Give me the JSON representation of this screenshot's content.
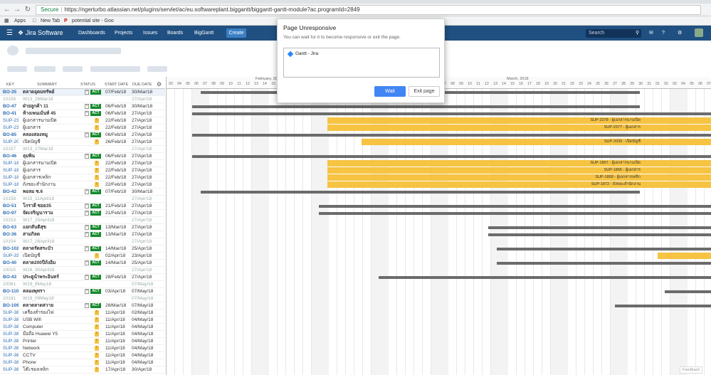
{
  "browser": {
    "security": "Secure",
    "url": "https://ngerturbo.atlassian.net/plugins/servlet/ac/eu.softwareplant.biggantt/biggantt-gantt-module?ac.programId=2849",
    "bookmarks": [
      "Apps",
      "New Tab",
      "potential site - Goo"
    ]
  },
  "jira": {
    "brand": "Jira Software",
    "nav": [
      "Dashboards",
      "Projects",
      "Issues",
      "Boards",
      "BigGantt"
    ],
    "create": "Create",
    "search_placeholder": "Search"
  },
  "table": {
    "headers": [
      "KEY",
      "SUMMARY",
      "STATUS",
      "START DATE",
      "DUE DATE"
    ],
    "rows": [
      {
        "key": "BO-35",
        "summary": "ตลาดอุดมทรัพย์",
        "status": "ACT",
        "start": "07/Feb/18",
        "due": "30/Mar/18",
        "type": "bold"
      },
      {
        "key": "10156",
        "summary": "W13_26Mar18",
        "status": "",
        "start": "",
        "due": "27/Apr/18",
        "type": "ver"
      },
      {
        "key": "BO-47",
        "summary": "ฝ่ายลูกค้า 11",
        "status": "ACT",
        "start": "06/Feb/18",
        "due": "30/Mar/18",
        "type": "bold"
      },
      {
        "key": "BO-41",
        "summary": "ห้างเพนเม้นท์ 45",
        "status": "ACT",
        "start": "06/Feb/18",
        "due": "27/Apr/18",
        "type": "bold"
      },
      {
        "key": "SUP-23",
        "summary": "ผู้เอกสารนาบเปิด",
        "status": "!",
        "start": "22/Feb/18",
        "due": "27/Apr/18",
        "type": "sub"
      },
      {
        "key": "SUP-23",
        "summary": "ผู้เอกสาร",
        "status": "!",
        "start": "22/Feb/18",
        "due": "27/Apr/18",
        "type": "sub"
      },
      {
        "key": "BO-85",
        "summary": "คลองสองหมู",
        "status": "ACT",
        "start": "06/Feb/18",
        "due": "27/Apr/18",
        "type": "bold"
      },
      {
        "key": "SUP-20",
        "summary": "เปิดบัญชี",
        "status": "!",
        "start": "26/Feb/18",
        "due": "27/Apr/18",
        "type": "sub"
      },
      {
        "key": "10157",
        "summary": "W13_27Mar18",
        "status": "",
        "start": "",
        "due": "27/Apr/18",
        "type": "ver"
      },
      {
        "key": "BO-46",
        "summary": "ลุมพิน",
        "status": "ACT",
        "start": "06/Feb/18",
        "due": "27/Apr/18",
        "type": "bold"
      },
      {
        "key": "SUP-18",
        "summary": "ผู้เอกสารนาบเปิด",
        "status": "!",
        "start": "22/Feb/18",
        "due": "27/Apr/18",
        "type": "sub"
      },
      {
        "key": "SUP-18",
        "summary": "ผู้เอกสาร",
        "status": "!",
        "start": "22/Feb/18",
        "due": "27/Apr/18",
        "type": "sub"
      },
      {
        "key": "SUP-18",
        "summary": "ผู้เอกสารเหล็ก",
        "status": "!",
        "start": "22/Feb/18",
        "due": "27/Apr/18",
        "type": "sub"
      },
      {
        "key": "SUP-18",
        "summary": "ถังขยะสำนักงาน",
        "status": "!",
        "start": "22/Feb/18",
        "due": "27/Apr/18",
        "type": "sub"
      },
      {
        "key": "BO-42",
        "summary": "พอลม ซ.6",
        "status": "ACT",
        "start": "07/Feb/18",
        "due": "30/Mar/18",
        "type": "bold"
      },
      {
        "key": "10158",
        "summary": "W15_11April18",
        "status": "",
        "start": "",
        "due": "27/Apr/18",
        "type": "ver"
      },
      {
        "key": "BO-51",
        "summary": "โกราดี ซอย35",
        "status": "ACT",
        "start": "21/Feb/18",
        "due": "27/Apr/18",
        "type": "bold"
      },
      {
        "key": "BO-97",
        "summary": "จัดเจริญนาราม",
        "status": "ACT",
        "start": "21/Feb/18",
        "due": "27/Apr/18",
        "type": "bold"
      },
      {
        "key": "10153",
        "summary": "W17_25April18",
        "status": "",
        "start": "",
        "due": "27/Apr/18",
        "type": "ver"
      },
      {
        "key": "BO-63",
        "summary": "แยกสันติสุข",
        "status": "ACT",
        "start": "13/Mar/18",
        "due": "27/Apr/18",
        "type": "bold"
      },
      {
        "key": "BO-36",
        "summary": "สามกิลด",
        "status": "ACT",
        "start": "13/Mar/18",
        "due": "27/Apr/18",
        "type": "bold"
      },
      {
        "key": "10154",
        "summary": "W17_26April18",
        "status": "",
        "start": "",
        "due": "27/Apr/18",
        "type": "ver"
      },
      {
        "key": "BO-102",
        "summary": "ตลาดรัดสระบัว",
        "status": "ACT",
        "start": "14/Mar/18",
        "due": "25/Apr/18",
        "type": "bold"
      },
      {
        "key": "SUP-33",
        "summary": "เปิดบัญชี",
        "status": "!",
        "start": "02/Apr/18",
        "due": "23/Apr/18",
        "type": "sub"
      },
      {
        "key": "BO-40",
        "summary": "ตลาด200ปีถังอิ่ม",
        "status": "ACT",
        "start": "14/Mar/18",
        "due": "25/Apr/18",
        "type": "bold"
      },
      {
        "key": "10015",
        "summary": "W16_30April18",
        "status": "",
        "start": "",
        "due": "27/Apr/18",
        "type": "ver"
      },
      {
        "key": "BO-43",
        "summary": "ประตูน้ำพระอินทร์",
        "status": "ACT",
        "start": "28/Feb/18",
        "due": "27/Apr/18",
        "type": "bold"
      },
      {
        "key": "10061",
        "summary": "W19_8May18",
        "status": "",
        "start": "",
        "due": "07/May/18",
        "type": "ver"
      },
      {
        "key": "BO-110",
        "summary": "คลองพุทรา",
        "status": "ACT",
        "start": "03/Apr/18",
        "due": "07/May/18",
        "type": "bold"
      },
      {
        "key": "10181",
        "summary": "W19_09May18",
        "status": "",
        "start": "",
        "due": "07/May/18",
        "type": "ver"
      },
      {
        "key": "BO-109",
        "summary": "ตลาดลาดสวาย",
        "status": "ACT",
        "start": "28/Mar/18",
        "due": "07/May/18",
        "type": "bold"
      },
      {
        "key": "SUP-38",
        "summary": "เครื่องสำรองไฟ",
        "status": "!",
        "start": "11/Apr/18",
        "due": "02/May/18",
        "type": "sub"
      },
      {
        "key": "SUP-38",
        "summary": "USB Wifi",
        "status": "!",
        "start": "11/Apr/18",
        "due": "04/May/18",
        "type": "sub"
      },
      {
        "key": "SUP-38",
        "summary": "Computer",
        "status": "!",
        "start": "11/Apr/18",
        "due": "04/May/18",
        "type": "sub"
      },
      {
        "key": "SUP-38",
        "summary": "มือถือ Huawei Y5",
        "status": "!",
        "start": "11/Apr/18",
        "due": "04/May/18",
        "type": "sub"
      },
      {
        "key": "SUP-38",
        "summary": "Printer",
        "status": "!",
        "start": "11/Apr/18",
        "due": "04/May/18",
        "type": "sub"
      },
      {
        "key": "SUP-38",
        "summary": "Network",
        "status": "!",
        "start": "11/Apr/18",
        "due": "04/May/18",
        "type": "sub"
      },
      {
        "key": "SUP-38",
        "summary": "CCTV",
        "status": "!",
        "start": "11/Apr/18",
        "due": "04/May/18",
        "type": "sub"
      },
      {
        "key": "SUP-38",
        "summary": "Phone",
        "status": "!",
        "start": "11/Apr/18",
        "due": "04/May/18",
        "type": "sub"
      },
      {
        "key": "SUP-38",
        "summary": "โต๊ะรองเหล็ก",
        "status": "!",
        "start": "17/Apr/18",
        "due": "30/Apr/18",
        "type": "sub"
      }
    ]
  },
  "gantt": {
    "months": [
      "February, 20",
      "March, 2018"
    ],
    "days": [
      "03",
      "04",
      "05",
      "06",
      "07",
      "08",
      "09",
      "10",
      "11",
      "12",
      "13",
      "14",
      "15",
      "16",
      "17",
      "18",
      "19",
      "20",
      "21",
      "22",
      "23",
      "24",
      "25",
      "26",
      "27",
      "28",
      "01",
      "02",
      "03",
      "04",
      "05",
      "06",
      "07",
      "08",
      "09",
      "10",
      "11",
      "12",
      "13",
      "14",
      "15",
      "16",
      "17",
      "18",
      "19",
      "20",
      "21",
      "22",
      "23",
      "24",
      "25",
      "26",
      "27",
      "28",
      "29",
      "30",
      "31",
      "01",
      "02",
      "03",
      "04",
      "05",
      "06",
      "07"
    ],
    "yellow_labels": [
      "SUP-2378 - ผู้เอกสารนาบเปิด",
      "SUP-2377 - ผู้เอกสาร",
      "SUP-2036 - เปิดบัญชี",
      "SUP-1867 - ผู้เอกสารนาบเปิด",
      "SUP-1866 - ผู้เอกสาร",
      "SUP-1868 - ผู้เอกสารเหล็ก",
      "SUP-1872 - ถังขยะสำนักงาน"
    ],
    "feedback": "Feedback"
  },
  "dialog": {
    "title": "Page Unresponsive",
    "message": "You can wait for it to become responsive or exit the page.",
    "item": "Gantt - Jira",
    "wait": "Wait",
    "exit": "Exit page"
  }
}
